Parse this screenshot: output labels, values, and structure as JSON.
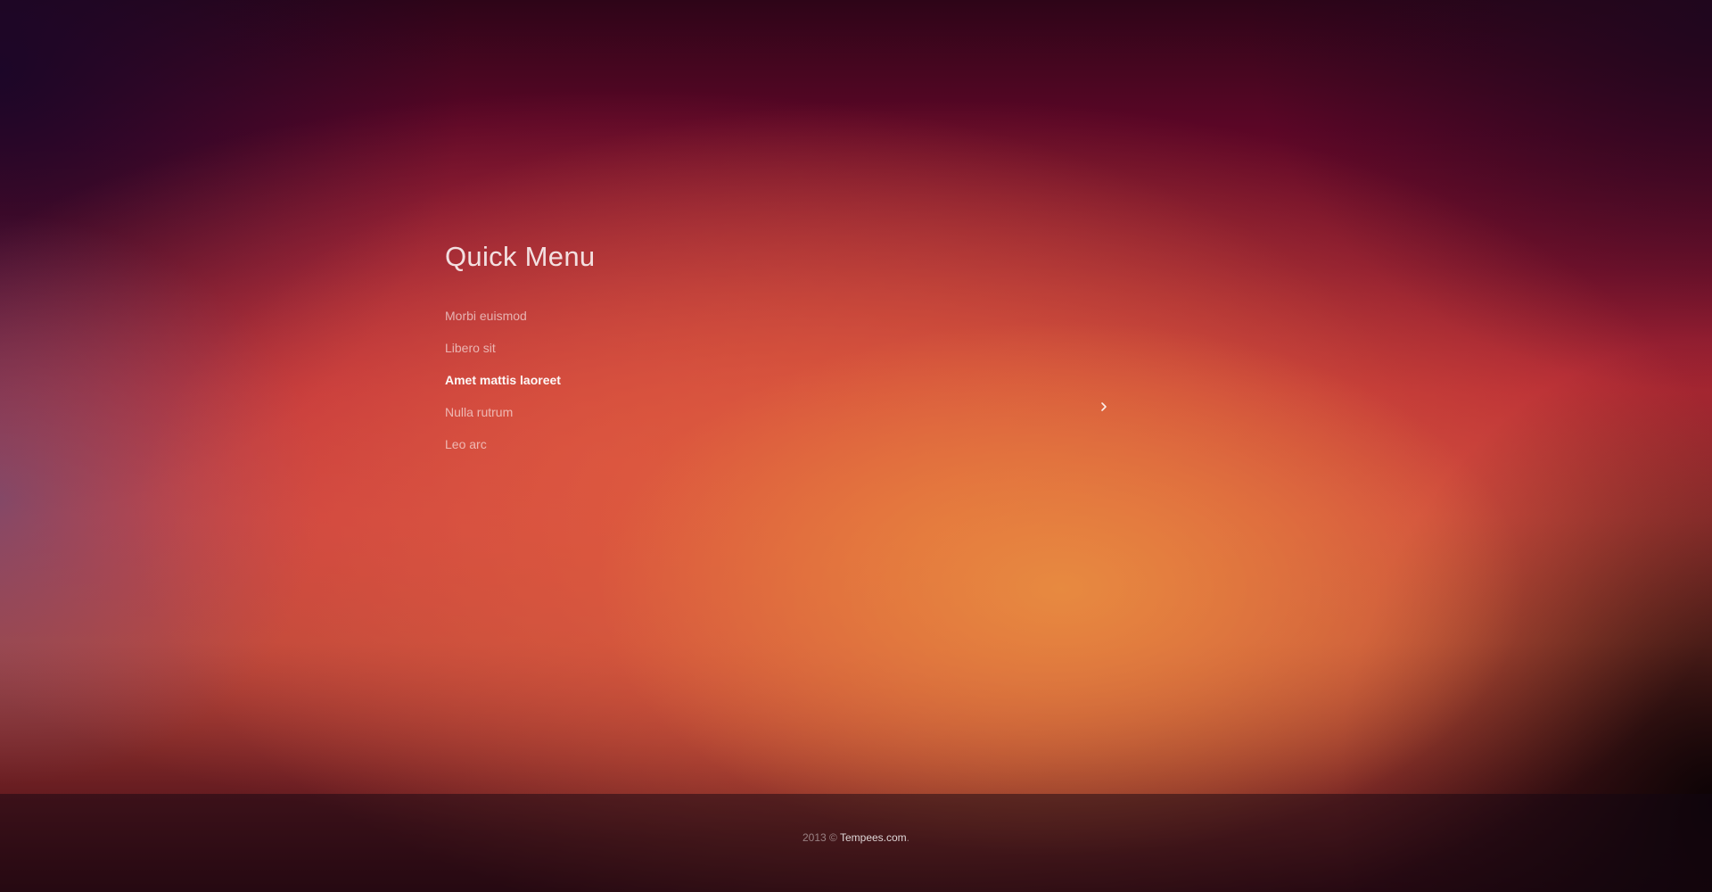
{
  "quick_menu": {
    "title": "Quick Menu",
    "items": [
      {
        "label": "Morbi euismod",
        "active": false
      },
      {
        "label": "Libero sit",
        "active": false
      },
      {
        "label": "Amet mattis laoreet",
        "active": true
      },
      {
        "label": "Nulla rutrum",
        "active": false
      },
      {
        "label": "Leo arc",
        "active": false
      }
    ]
  },
  "navigation": {
    "next_icon": "chevron-right-icon"
  },
  "footer": {
    "year_copyright": "2013 ©",
    "site_link": "Tempees.com",
    "period": "."
  },
  "colors": {
    "text_active": "#ffffff",
    "accent_orange": "#e88c40",
    "accent_red": "#c8403e",
    "background_dark": "#2e0518"
  }
}
